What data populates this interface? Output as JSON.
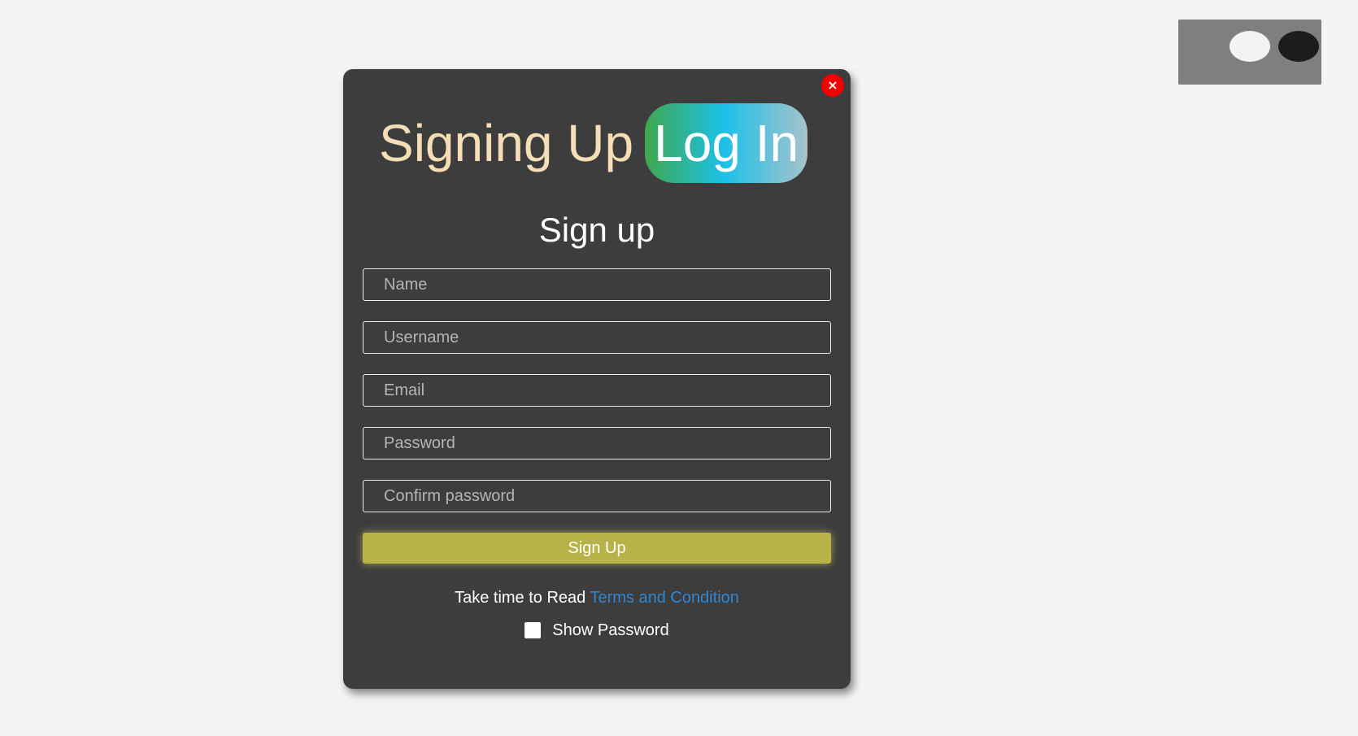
{
  "modal": {
    "close_icon": "×",
    "header_title": "Signing Up",
    "switch_label": "Log In",
    "form_title": "Sign up",
    "fields": [
      {
        "placeholder": "Name"
      },
      {
        "placeholder": "Username"
      },
      {
        "placeholder": "Email"
      },
      {
        "placeholder": "Password"
      },
      {
        "placeholder": "Confirm password"
      }
    ],
    "submit_label": "Sign Up",
    "terms_prefix": "Take time to Read ",
    "terms_link": "Terms and Condition",
    "show_password_label": "Show Password"
  },
  "colors": {
    "page_bg": "#f4f4f4",
    "modal_bg": "#3d3d3d",
    "header_title": "#f5ddb5",
    "submit_bg": "#b8b348",
    "link": "#2f86d4",
    "close_bg": "#f40000",
    "toggle_bg": "#7f7f7f"
  },
  "icons": {
    "close": "close-icon",
    "theme_toggle": "theme-toggle-icon"
  }
}
